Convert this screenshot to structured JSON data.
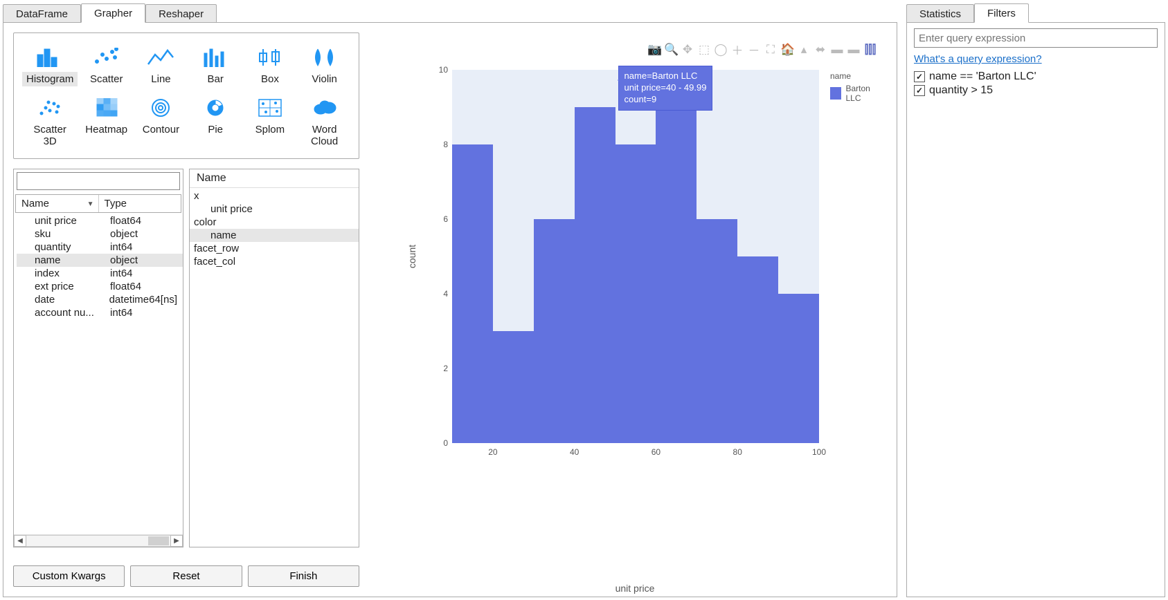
{
  "tabs_main": [
    "DataFrame",
    "Grapher",
    "Reshaper"
  ],
  "tabs_main_active": 1,
  "tabs_side": [
    "Statistics",
    "Filters"
  ],
  "tabs_side_active": 1,
  "chart_types_row1": [
    {
      "id": "histogram",
      "label": "Histogram"
    },
    {
      "id": "scatter",
      "label": "Scatter"
    },
    {
      "id": "line",
      "label": "Line"
    },
    {
      "id": "bar",
      "label": "Bar"
    },
    {
      "id": "box",
      "label": "Box"
    },
    {
      "id": "violin",
      "label": "Violin"
    }
  ],
  "chart_types_row2": [
    {
      "id": "scatter3d",
      "label": "Scatter 3D"
    },
    {
      "id": "heatmap",
      "label": "Heatmap"
    },
    {
      "id": "contour",
      "label": "Contour"
    },
    {
      "id": "pie",
      "label": "Pie"
    },
    {
      "id": "splom",
      "label": "Splom"
    },
    {
      "id": "wordcloud",
      "label": "Word Cloud"
    }
  ],
  "chart_type_selected": "histogram",
  "columns_table": {
    "headers": [
      "Name",
      "Type"
    ],
    "rows": [
      {
        "name": "unit price",
        "type": "float64"
      },
      {
        "name": "sku",
        "type": "object"
      },
      {
        "name": "quantity",
        "type": "int64"
      },
      {
        "name": "name",
        "type": "object",
        "selected": true
      },
      {
        "name": "index",
        "type": "int64"
      },
      {
        "name": "ext price",
        "type": "float64"
      },
      {
        "name": "date",
        "type": "datetime64[ns]"
      },
      {
        "name": "account nu...",
        "type": "int64"
      }
    ]
  },
  "dropzone": {
    "title": "Name",
    "groups": [
      {
        "key": "x",
        "items": [
          {
            "label": "unit price"
          }
        ]
      },
      {
        "key": "color",
        "items": [
          {
            "label": "name",
            "selected": true
          }
        ]
      },
      {
        "key": "facet_row",
        "items": []
      },
      {
        "key": "facet_col",
        "items": []
      }
    ]
  },
  "buttons": {
    "custom": "Custom Kwargs",
    "reset": "Reset",
    "finish": "Finish"
  },
  "modebar_icons": [
    "camera",
    "zoom",
    "pan",
    "select",
    "lasso",
    "zoomin",
    "zoomout",
    "autoscale",
    "reset",
    "spike",
    "compare",
    "box",
    "logo"
  ],
  "legend_title": "name",
  "legend_items": [
    "Barton LLC"
  ],
  "tooltip": {
    "line1": "name=Barton LLC",
    "line2": "unit price=40 - 49.99",
    "line3": "count=9"
  },
  "chart_data": {
    "type": "bar",
    "title": "",
    "xlabel": "unit price",
    "ylabel": "count",
    "xlim": [
      10,
      100
    ],
    "ylim": [
      0,
      10
    ],
    "x_ticks": [
      20,
      40,
      60,
      80,
      100
    ],
    "y_ticks": [
      0,
      2,
      4,
      6,
      8,
      10
    ],
    "series": [
      {
        "name": "Barton LLC",
        "color": "#6272df",
        "bin_edges": [
          10,
          20,
          30,
          40,
          50,
          60,
          70,
          80,
          90,
          100
        ],
        "values": [
          8,
          3,
          6,
          9,
          8,
          10,
          6,
          5,
          4
        ]
      }
    ]
  },
  "filters_panel": {
    "input_placeholder": "Enter query expression",
    "link": "What's a query expression?",
    "items": [
      {
        "checked": true,
        "expr": "name == 'Barton LLC'"
      },
      {
        "checked": true,
        "expr": "quantity > 15"
      }
    ]
  }
}
